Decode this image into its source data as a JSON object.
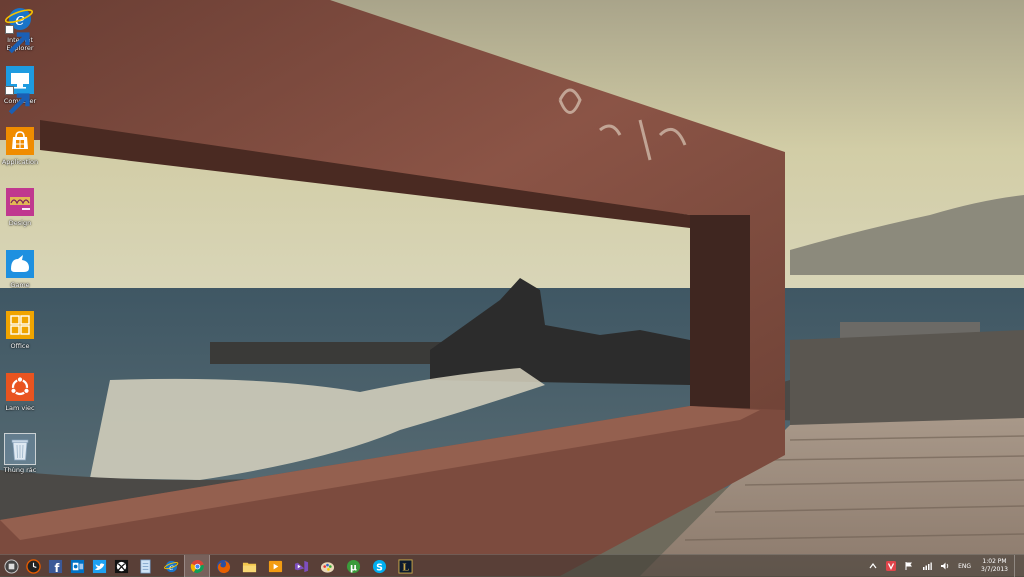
{
  "desktop": {
    "icons": [
      {
        "label": "Internet Explorer",
        "icon": "internet-explorer-icon",
        "shortcut": true
      },
      {
        "label": "Computer",
        "icon": "computer-icon",
        "shortcut": true
      },
      {
        "label": "Application",
        "icon": "windows-store-icon",
        "shortcut": false
      },
      {
        "label": "Design",
        "icon": "design-folder-icon",
        "shortcut": false
      },
      {
        "label": "Game",
        "icon": "game-folder-icon",
        "shortcut": false
      },
      {
        "label": "Office",
        "icon": "office-folder-icon",
        "shortcut": false
      },
      {
        "label": "Lam viec",
        "icon": "ubuntu-folder-icon",
        "shortcut": false
      },
      {
        "label": "Thùng rác",
        "icon": "recycle-bin-icon",
        "shortcut": false
      }
    ]
  },
  "taskbar": {
    "buttons": [
      "start-orb-icon",
      "clock-app-icon",
      "facebook-icon",
      "outlook-icon",
      "twitter-icon",
      "xbox-icon",
      "notepad-icon",
      "internet-explorer-icon",
      "chrome-icon",
      "firefox-icon",
      "file-explorer-icon",
      "media-player-icon",
      "visual-studio-icon",
      "paint-icon",
      "utorrent-icon",
      "skype-icon",
      "league-icon"
    ],
    "tray": {
      "language": "ENG",
      "time": "1:02 PM",
      "date": "3/7/2013"
    }
  },
  "colors": {
    "taskbar_bg": "#3c3732",
    "ie_blue": "#1a74c8",
    "store_orange": "#f08c00",
    "design_magenta": "#c0388f",
    "game_blue": "#1e90e0",
    "office_yellow": "#f0a400",
    "ubuntu_orange": "#e95420"
  }
}
